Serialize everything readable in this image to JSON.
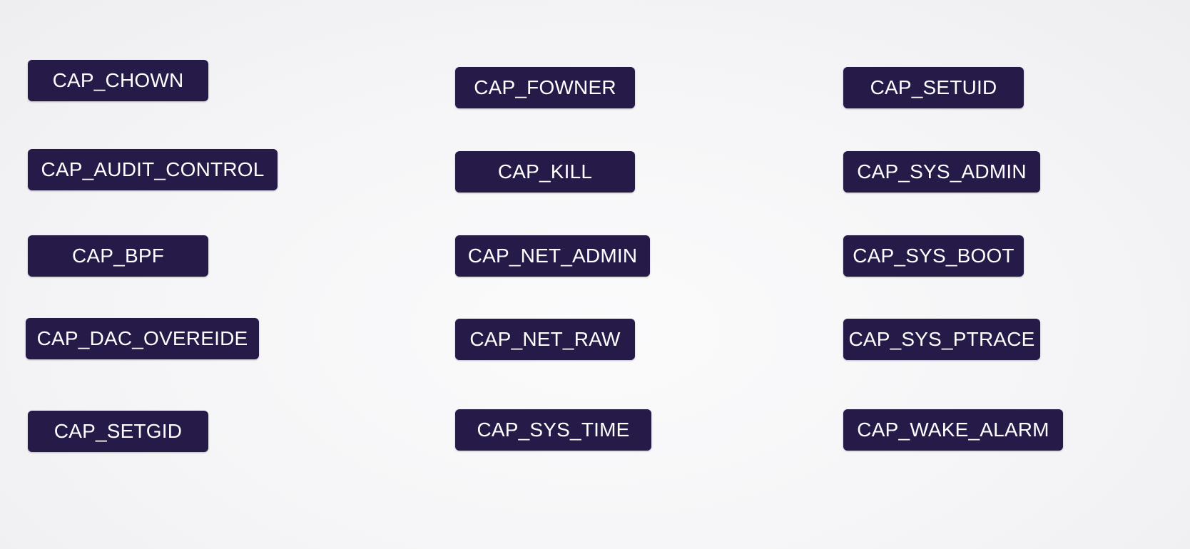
{
  "capabilities": {
    "column1": [
      "CAP_CHOWN",
      "CAP_AUDIT_CONTROL",
      "CAP_BPF",
      "CAP_DAC_OVEREIDE",
      "CAP_SETGID"
    ],
    "column2": [
      "CAP_FOWNER",
      "CAP_KILL",
      "CAP_NET_ADMIN",
      "CAP_NET_RAW",
      "CAP_SYS_TIME"
    ],
    "column3": [
      "CAP_SETUID",
      "CAP_SYS_ADMIN",
      "CAP_SYS_BOOT",
      "CAP_SYS_PTRACE",
      "CAP_WAKE_ALARM"
    ]
  },
  "colors": {
    "box_fill": "#251a48",
    "box_text": "#ffffff",
    "background": "#f5f5f7"
  }
}
